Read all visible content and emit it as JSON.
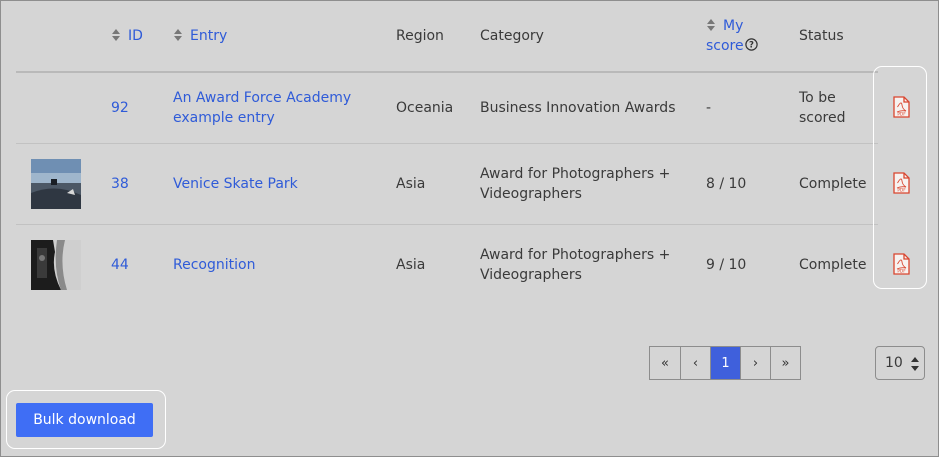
{
  "table": {
    "headers": {
      "id": "ID",
      "entry": "Entry",
      "region": "Region",
      "category": "Category",
      "my_score_line1": "My",
      "my_score_line2": "score",
      "status": "Status"
    },
    "rows": [
      {
        "id": "92",
        "entry_line1": "An Award Force Academy",
        "entry_line2": "example entry",
        "region": "Oceania",
        "category_line1": "Business Innovation Awards",
        "category_line2": "",
        "score": "-",
        "status_line1": "To be",
        "status_line2": "scored",
        "pdf_icon": "pdf-file-icon"
      },
      {
        "id": "38",
        "entry_line1": "Venice Skate Park",
        "entry_line2": "",
        "region": "Asia",
        "category_line1": "Award for Photographers +",
        "category_line2": "Videographers",
        "score": "8 / 10",
        "status_line1": "Complete",
        "status_line2": "",
        "pdf_icon": "pdf-file-icon"
      },
      {
        "id": "44",
        "entry_line1": "Recognition",
        "entry_line2": "",
        "region": "Asia",
        "category_line1": "Award for Photographers +",
        "category_line2": "Videographers",
        "score": "9 / 10",
        "status_line1": "Complete",
        "status_line2": "",
        "pdf_icon": "pdf-file-icon"
      }
    ]
  },
  "pagination": {
    "first": "«",
    "prev": "‹",
    "current": "1",
    "next": "›",
    "last": "»"
  },
  "per_page": {
    "selected": "10"
  },
  "bulk_download": {
    "label": "Bulk download"
  },
  "colors": {
    "link": "#2f5bd8",
    "accent": "#3f6ef5",
    "pdf_red": "#d9452f",
    "background": "#d5d5d5"
  }
}
